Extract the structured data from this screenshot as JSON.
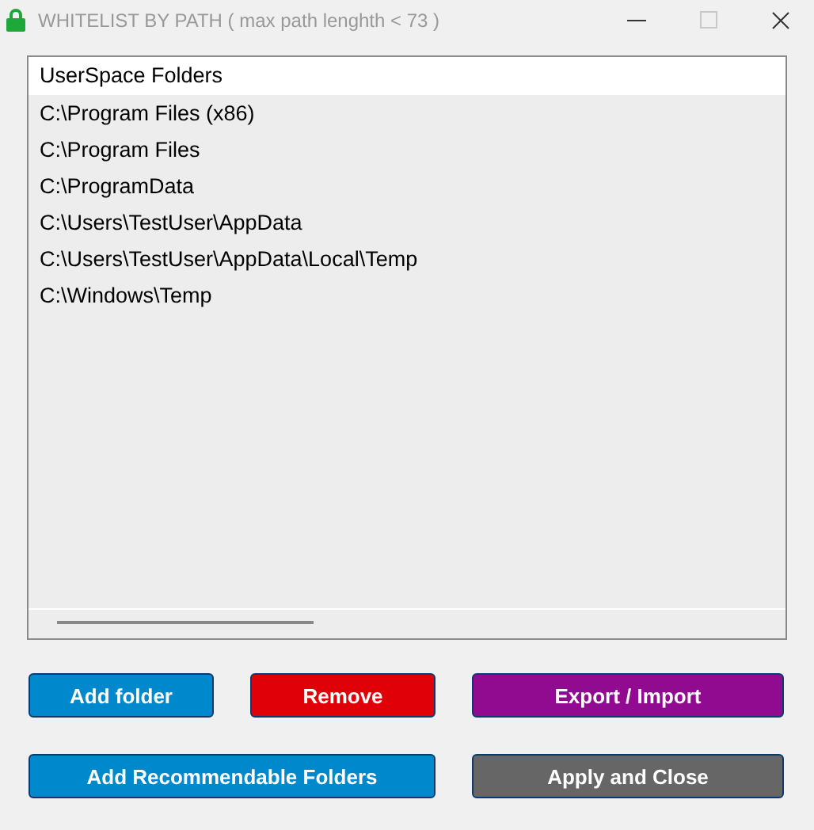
{
  "window": {
    "title": "WHITELIST BY PATH ( max path lenghth < 73 )",
    "maximize_disabled": true
  },
  "list": {
    "header": "UserSpace Folders",
    "items": [
      "C:\\Program Files (x86)",
      "C:\\Program Files",
      "C:\\ProgramData",
      "C:\\Users\\TestUser\\AppData",
      "C:\\Users\\TestUser\\AppData\\Local\\Temp",
      "C:\\Windows\\Temp"
    ]
  },
  "buttons": [
    {
      "label": "Add folder",
      "color": "#0088cc"
    },
    {
      "label": "Remove",
      "color": "#e00008"
    },
    {
      "label": "Export / Import",
      "color": "#900b8f"
    },
    {
      "label": "Add Recommendable Folders",
      "color": "#0088cc"
    },
    {
      "label": "Apply and Close",
      "color": "#666666"
    }
  ]
}
